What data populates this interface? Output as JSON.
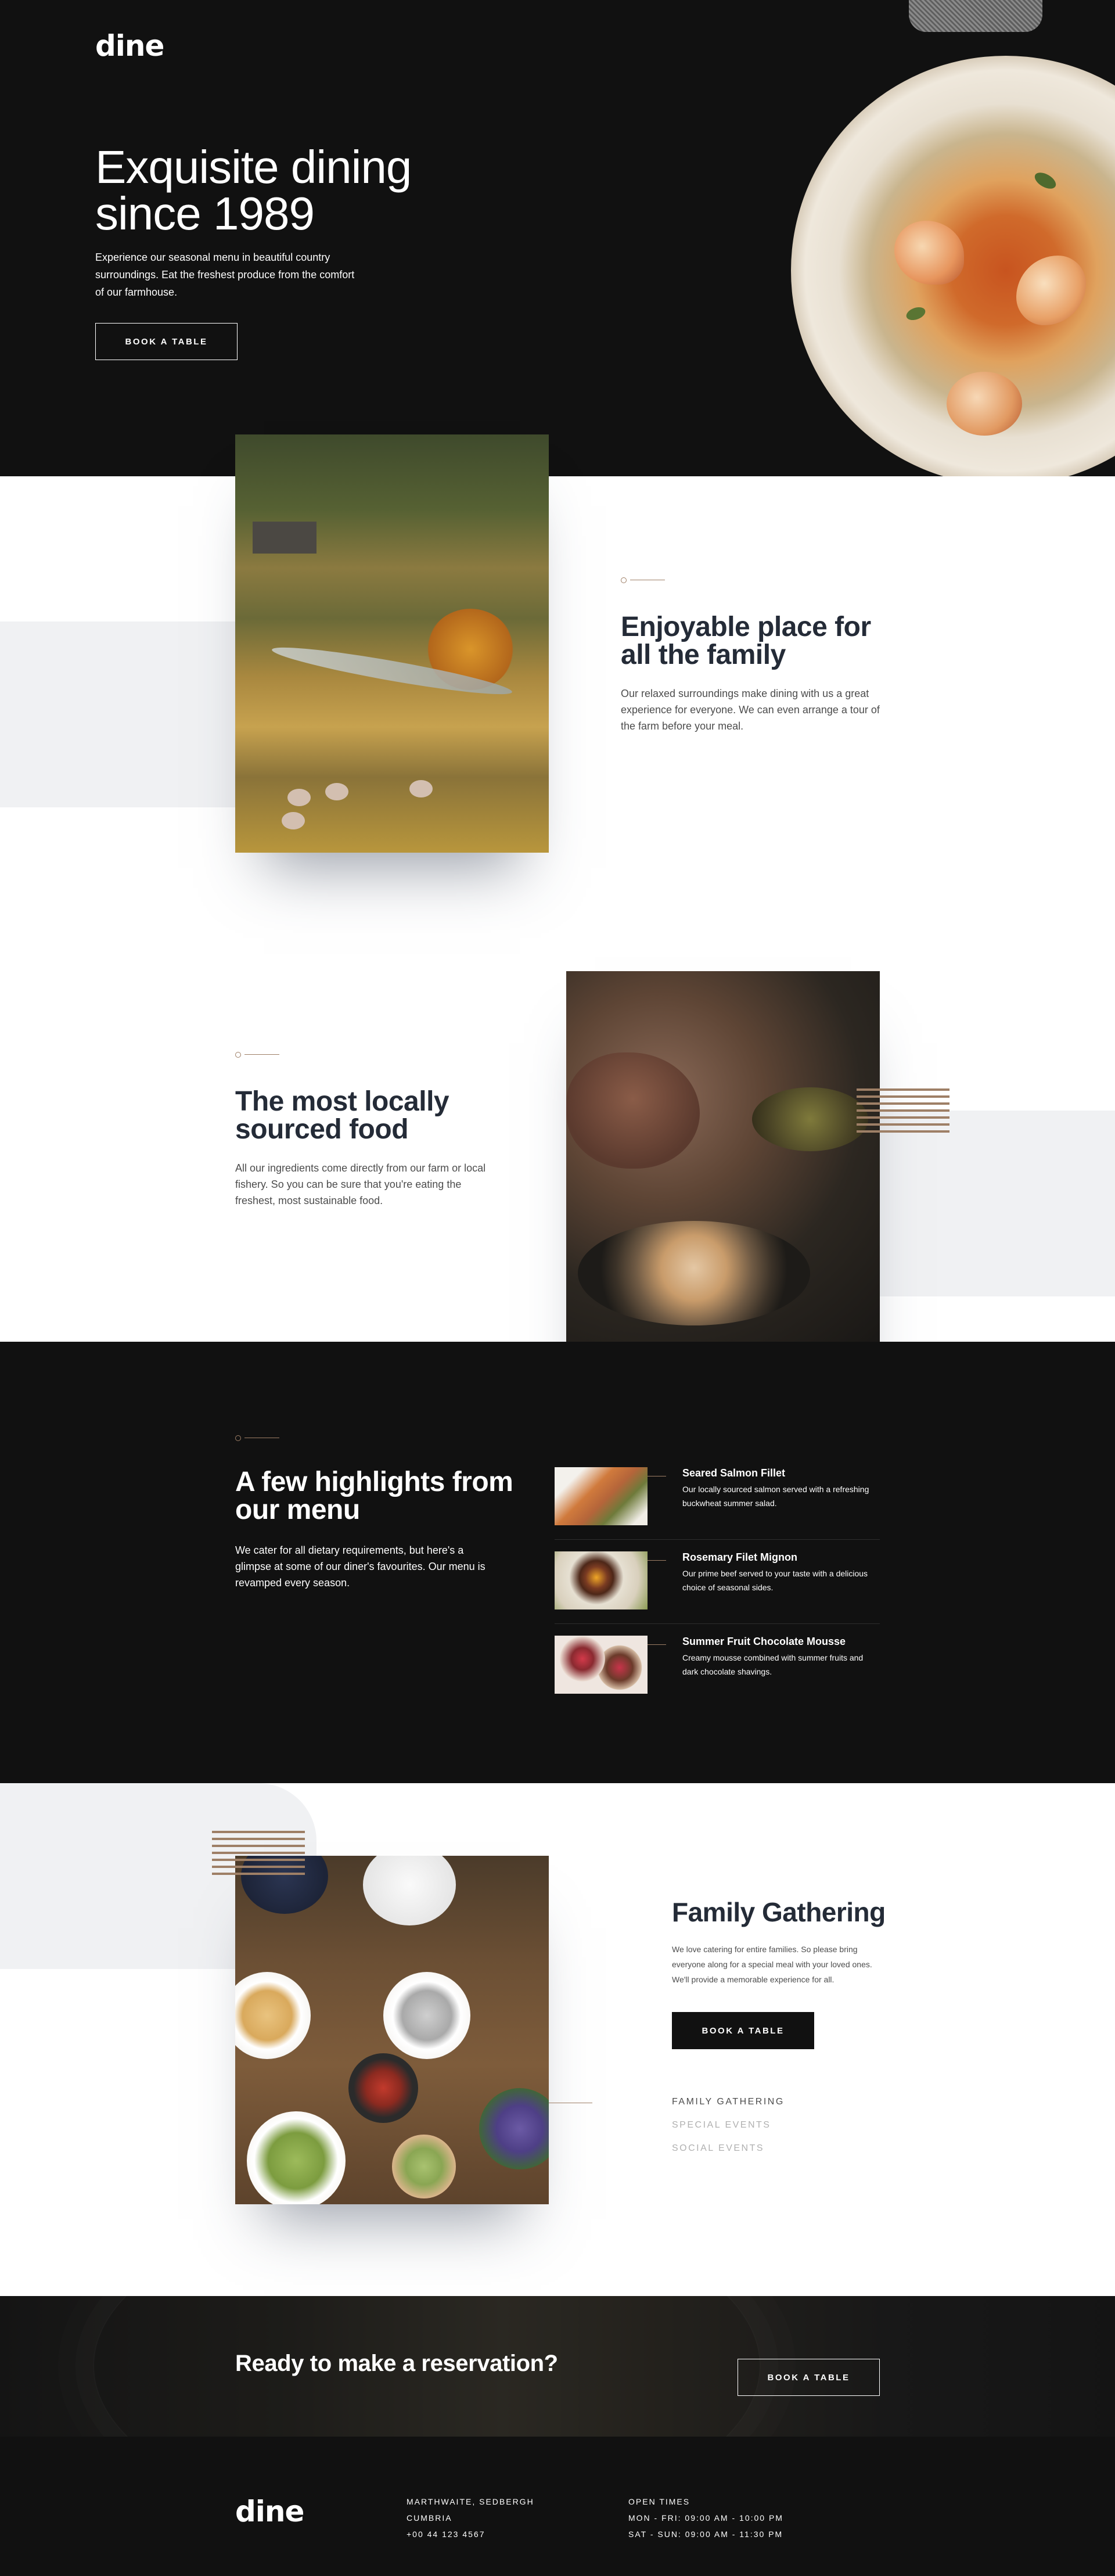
{
  "brand": {
    "logo": "dine"
  },
  "hero": {
    "title_line1": "Exquisite dining",
    "title_line2": "since 1989",
    "text": "Experience our seasonal menu in beautiful country surroundings. Eat the freshest produce from the comfort of our farmhouse.",
    "button": "BOOK A TABLE"
  },
  "section_family": {
    "title_line1": "Enjoyable place for",
    "title_line2": "all the family",
    "text": "Our relaxed surroundings make dining with us a great experience for everyone. We can even arrange a tour of the farm before your meal."
  },
  "section_local": {
    "title_line1": "The most locally",
    "title_line2": "sourced food",
    "text": "All our ingredients come directly from our farm or local fishery. So you can be sure that you're eating the freshest, most sustainable food."
  },
  "highlights": {
    "title_line1": "A few highlights from",
    "title_line2": "our menu",
    "text": "We cater for all dietary requirements, but here's a glimpse at some of our diner's favourites. Our menu is revamped every season.",
    "items": [
      {
        "name": "Seared Salmon Fillet",
        "desc": "Our locally sourced salmon served with a refreshing buckwheat summer salad."
      },
      {
        "name": "Rosemary Filet Mignon",
        "desc": "Our prime beef served to your taste with a delicious choice of seasonal sides."
      },
      {
        "name": "Summer Fruit Chocolate Mousse",
        "desc": "Creamy mousse combined with summer fruits and dark chocolate shavings."
      }
    ]
  },
  "events": {
    "title": "Family Gathering",
    "text": "We love catering for entire families. So please bring everyone along for a special meal with your loved ones. We'll provide a memorable experience for all.",
    "button": "BOOK A TABLE",
    "tabs": [
      "FAMILY GATHERING",
      "SPECIAL EVENTS",
      "SOCIAL EVENTS"
    ],
    "active_tab": "FAMILY GATHERING"
  },
  "reservation": {
    "title": "Ready to make a reservation?",
    "button": "BOOK A TABLE"
  },
  "footer": {
    "address_line1": "MARTHWAITE, SEDBERGH",
    "address_line2": "CUMBRIA",
    "phone": "+00 44 123 4567",
    "hours_title": "OPEN TIMES",
    "hours_weekday": "MON - FRI: 09:00 AM - 10:00 PM",
    "hours_weekend": "SAT - SUN: 09:00 AM - 11:30 PM"
  },
  "colors": {
    "dark": "#111111",
    "accent": "#9e7f66",
    "heading": "#242b37",
    "grey_block": "#f0f1f3"
  }
}
